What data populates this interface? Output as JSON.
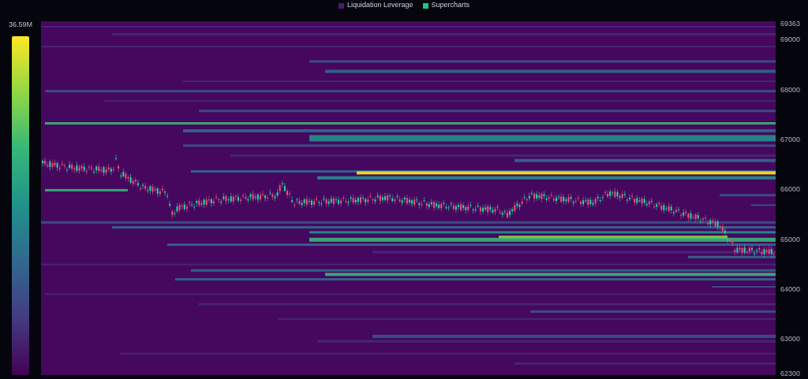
{
  "legend": [
    {
      "label": "Liquidation Leverage",
      "color": "#4a1a6e"
    },
    {
      "label": "Supercharts",
      "color": "#22c38e"
    }
  ],
  "color_scale": {
    "max_label": "36.59M"
  },
  "price_axis": {
    "ticks": [
      "69363",
      "69000",
      "68000",
      "67000",
      "66000",
      "65000",
      "64000",
      "63000",
      "62300"
    ]
  }
}
